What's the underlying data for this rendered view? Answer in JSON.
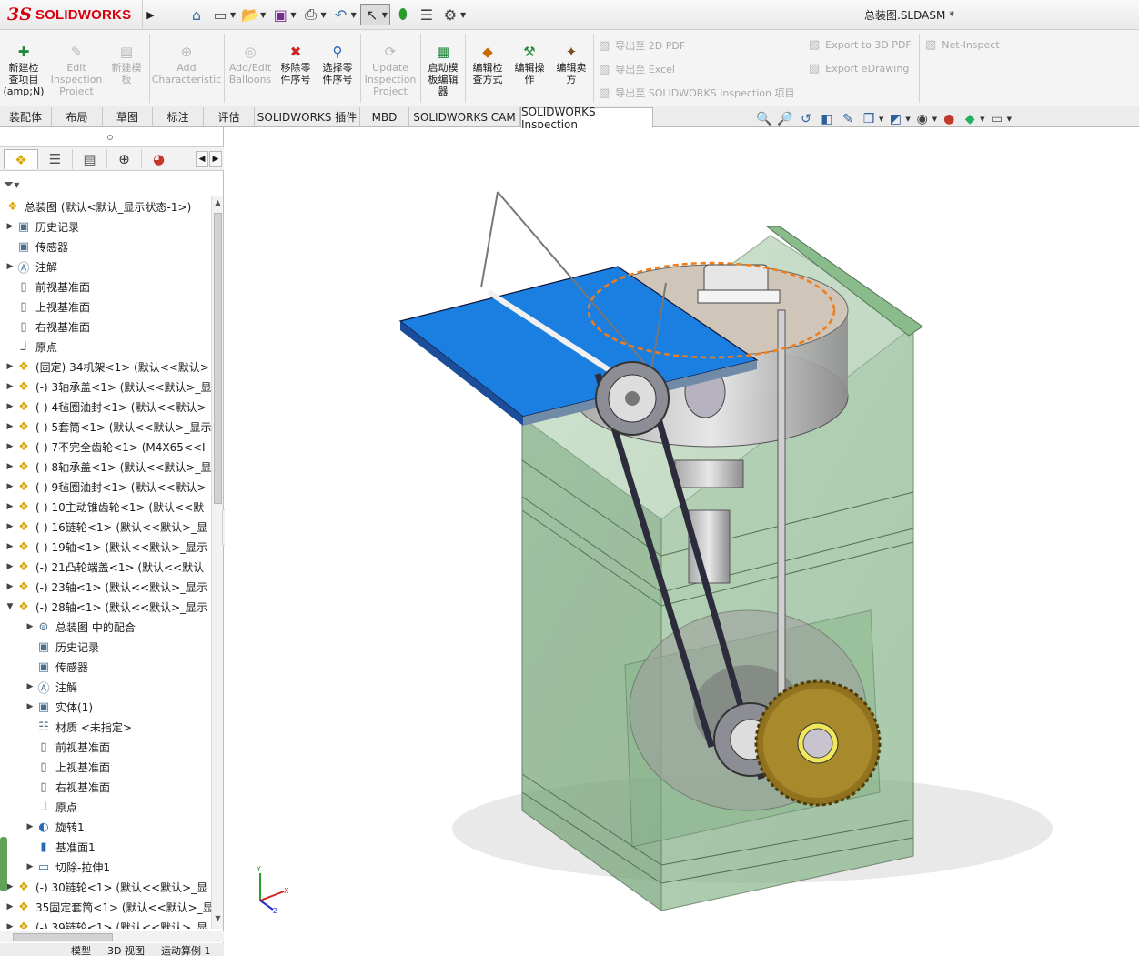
{
  "titlebar": {
    "logo_ds": "3S",
    "logo_text": "SOLIDWORKS",
    "document_title": "总装图.SLDASM *",
    "quick_icons": [
      "home-icon",
      "new-document-icon",
      "open-folder-icon",
      "save-icon",
      "print-icon",
      "undo-icon",
      "select-arrow-icon",
      "traffic-light-icon",
      "file-properties-icon",
      "options-gear-icon"
    ]
  },
  "command_manager": {
    "buttons": [
      {
        "name": "new-inspection-project",
        "label": "新建检\n查项目\n(amp;N)",
        "enabled": true
      },
      {
        "name": "edit-inspection-project",
        "label": "Edit\nInspection\nProject",
        "enabled": false
      },
      {
        "name": "new-template",
        "label": "新建模\n板",
        "enabled": false
      },
      {
        "name": "add-characteristic",
        "label": "Add\nCharacteristic",
        "enabled": false
      },
      {
        "name": "add-edit-balloons",
        "label": "Add/Edit\nBalloons",
        "enabled": false
      },
      {
        "name": "remove-part-sequence",
        "label": "移除零\n件序号",
        "enabled": true
      },
      {
        "name": "select-part-sequence",
        "label": "选择零\n件序号",
        "enabled": true
      },
      {
        "name": "update-inspection-project",
        "label": "Update\nInspection\nProject",
        "enabled": false
      },
      {
        "name": "launch-template-editor",
        "label": "启动模\n板编辑\n器",
        "enabled": true
      },
      {
        "name": "edit-inspection-method",
        "label": "编辑检\n查方式",
        "enabled": true
      },
      {
        "name": "edit-operation",
        "label": "编辑操\n作",
        "enabled": true
      },
      {
        "name": "edit-vendor",
        "label": "编辑卖\n方",
        "enabled": true
      }
    ],
    "export_left": [
      "导出至 2D PDF",
      "导出至 Excel",
      "导出至 SOLIDWORKS Inspection 项目"
    ],
    "export_right": [
      "Export to 3D PDF",
      "Export eDrawing"
    ],
    "net_inspect": "Net-Inspect"
  },
  "tabs": [
    "装配体",
    "布局",
    "草图",
    "标注",
    "评估",
    "SOLIDWORKS 插件",
    "MBD",
    "SOLIDWORKS CAM",
    "SOLIDWORKS Inspection"
  ],
  "active_tab": "SOLIDWORKS Inspection",
  "feature_tree": {
    "items": [
      {
        "label": "总装图  (默认<默认_显示状态-1>)",
        "icon": "assembly",
        "indent": 0,
        "expander": ""
      },
      {
        "label": "历史记录",
        "icon": "folder",
        "indent": 1,
        "expander": "▶"
      },
      {
        "label": "传感器",
        "icon": "folder",
        "indent": 1,
        "expander": ""
      },
      {
        "label": "注解",
        "icon": "annotation",
        "indent": 1,
        "expander": "▶"
      },
      {
        "label": "前视基准面",
        "icon": "plane",
        "indent": 1,
        "expander": ""
      },
      {
        "label": "上视基准面",
        "icon": "plane",
        "indent": 1,
        "expander": ""
      },
      {
        "label": "右视基准面",
        "icon": "plane",
        "indent": 1,
        "expander": ""
      },
      {
        "label": "原点",
        "icon": "origin",
        "indent": 1,
        "expander": ""
      },
      {
        "label": "(固定) 34机架<1> (默认<<默认>",
        "icon": "part",
        "indent": 1,
        "expander": "▶"
      },
      {
        "label": "(-) 3轴承盖<1> (默认<<默认>_显",
        "icon": "part",
        "indent": 1,
        "expander": "▶"
      },
      {
        "label": "(-) 4毡圈油封<1> (默认<<默认>",
        "icon": "part",
        "indent": 1,
        "expander": "▶"
      },
      {
        "label": "(-) 5套筒<1> (默认<<默认>_显示",
        "icon": "part",
        "indent": 1,
        "expander": "▶"
      },
      {
        "label": "(-) 7不完全齿轮<1> (M4X65<<I",
        "icon": "part",
        "indent": 1,
        "expander": "▶"
      },
      {
        "label": "(-) 8轴承盖<1> (默认<<默认>_显",
        "icon": "part",
        "indent": 1,
        "expander": "▶"
      },
      {
        "label": "(-) 9毡圈油封<1> (默认<<默认>",
        "icon": "part",
        "indent": 1,
        "expander": "▶"
      },
      {
        "label": "(-) 10主动锥齿轮<1> (默认<<默",
        "icon": "part",
        "indent": 1,
        "expander": "▶"
      },
      {
        "label": "(-) 16链轮<1> (默认<<默认>_显",
        "icon": "part",
        "indent": 1,
        "expander": "▶"
      },
      {
        "label": "(-) 19轴<1> (默认<<默认>_显示",
        "icon": "part",
        "indent": 1,
        "expander": "▶"
      },
      {
        "label": "(-) 21凸轮端盖<1> (默认<<默认",
        "icon": "part",
        "indent": 1,
        "expander": "▶"
      },
      {
        "label": "(-) 23轴<1> (默认<<默认>_显示",
        "icon": "part",
        "indent": 1,
        "expander": "▶"
      },
      {
        "label": "(-) 28轴<1> (默认<<默认>_显示",
        "icon": "part",
        "indent": 1,
        "expander": "▼"
      },
      {
        "label": "总装图 中的配合",
        "icon": "mates",
        "indent": 2,
        "expander": "▶"
      },
      {
        "label": "历史记录",
        "icon": "folder",
        "indent": 2,
        "expander": ""
      },
      {
        "label": "传感器",
        "icon": "folder",
        "indent": 2,
        "expander": ""
      },
      {
        "label": "注解",
        "icon": "annotation",
        "indent": 2,
        "expander": "▶"
      },
      {
        "label": "实体(1)",
        "icon": "folder",
        "indent": 2,
        "expander": "▶"
      },
      {
        "label": "材质 <未指定>",
        "icon": "material",
        "indent": 2,
        "expander": ""
      },
      {
        "label": "前视基准面",
        "icon": "plane",
        "indent": 2,
        "expander": ""
      },
      {
        "label": "上视基准面",
        "icon": "plane",
        "indent": 2,
        "expander": ""
      },
      {
        "label": "右视基准面",
        "icon": "plane",
        "indent": 2,
        "expander": ""
      },
      {
        "label": "原点",
        "icon": "origin",
        "indent": 2,
        "expander": ""
      },
      {
        "label": "旋转1",
        "icon": "revolve",
        "indent": 2,
        "expander": "▶"
      },
      {
        "label": "基准面1",
        "icon": "plane2",
        "indent": 2,
        "expander": ""
      },
      {
        "label": "切除-拉伸1",
        "icon": "cut",
        "indent": 2,
        "expander": "▶"
      },
      {
        "label": "(-) 30链轮<1> (默认<<默认>_显",
        "icon": "part",
        "indent": 1,
        "expander": "▶"
      },
      {
        "label": "35固定套筒<1> (默认<<默认>_显",
        "icon": "part",
        "indent": 1,
        "expander": "▶"
      },
      {
        "label": "(-) 39链轮<1> (默认<<默认>_显",
        "icon": "part",
        "indent": 1,
        "expander": "▶"
      }
    ]
  },
  "bottom_tabs": [
    "模型",
    "3D 视图",
    "运动算例 1"
  ],
  "triad": {
    "x": "X",
    "y": "Y",
    "z": "Z"
  },
  "colors": {
    "accent_red": "#d7000f",
    "enabled_icon": "#1f8a3a",
    "disabled_text": "#a8a8a8",
    "housing_green": "#86b98a",
    "plate_blue": "#1a7fe0"
  }
}
